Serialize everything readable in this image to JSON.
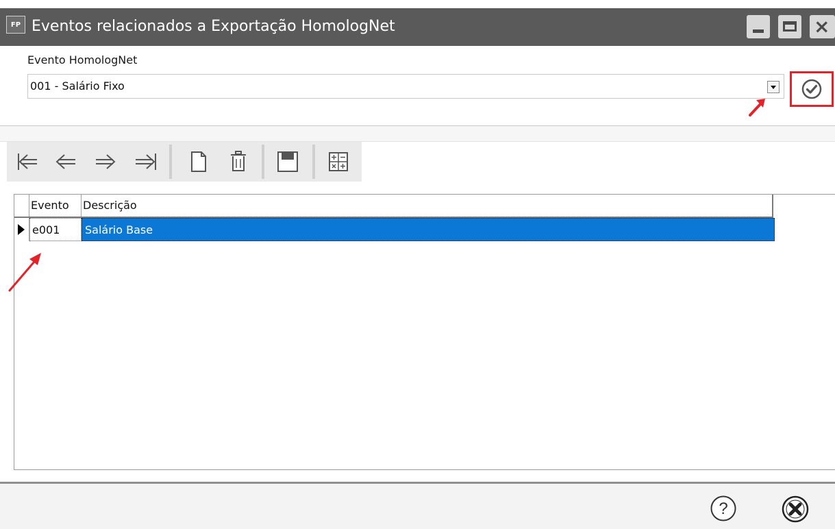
{
  "window": {
    "app_icon_text": "FP",
    "title": "Eventos relacionados a Exportação HomologNet",
    "controls": {
      "minimize": "minimize-icon",
      "maximize": "maximize-icon",
      "close": "close-icon"
    }
  },
  "form": {
    "label": "Evento HomologNet",
    "selected_value": "001 - Salário Fixo",
    "confirm_icon": "check-circle-icon"
  },
  "toolbar": {
    "buttons": [
      "first-record-icon",
      "previous-record-icon",
      "next-record-icon",
      "last-record-icon",
      "new-record-icon",
      "delete-record-icon",
      "save-record-icon",
      "calculator-icon"
    ]
  },
  "grid": {
    "columns": [
      "Evento",
      "Descrição"
    ],
    "rows": [
      {
        "evento": "e001",
        "descricao": "Salário Base",
        "selected": true
      }
    ]
  },
  "footer": {
    "help_icon": "help-icon",
    "close_icon": "close-circle-icon"
  },
  "colors": {
    "titlebar": "#5a5a5a",
    "selection": "#0b78d6",
    "highlight_border": "#e32229",
    "annotation_arrow": "#e32229"
  }
}
